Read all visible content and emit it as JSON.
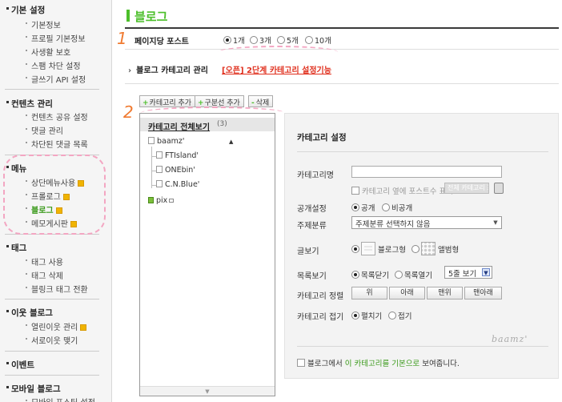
{
  "sidebar": {
    "sections": [
      {
        "title": "기본 설정",
        "items": [
          {
            "label": "기본정보",
            "badge": false
          },
          {
            "label": "프로필 기본정보",
            "badge": false
          },
          {
            "label": "사생활 보호",
            "badge": false
          },
          {
            "label": "스팸 차단 설정",
            "badge": false
          },
          {
            "label": "글쓰기 API 설정",
            "badge": false
          }
        ]
      },
      {
        "title": "컨텐츠 관리",
        "items": [
          {
            "label": "컨텐츠 공유 설정",
            "badge": false
          },
          {
            "label": "댓글 관리",
            "badge": false
          },
          {
            "label": "차단된 댓글 목록",
            "badge": false
          }
        ]
      },
      {
        "title": "메뉴",
        "items": [
          {
            "label": "상단메뉴사용",
            "badge": true
          },
          {
            "label": "프롤로그",
            "badge": true
          },
          {
            "label": "블로그",
            "badge": true,
            "active": true
          },
          {
            "label": "메모게시판",
            "badge": true
          }
        ]
      },
      {
        "title": "태그",
        "items": [
          {
            "label": "태그 사용",
            "badge": false
          },
          {
            "label": "태그 삭제",
            "badge": false
          },
          {
            "label": "블링크 태그 전환",
            "badge": false
          }
        ]
      },
      {
        "title": "이웃 블로그",
        "items": [
          {
            "label": "열린이웃 관리",
            "badge": true
          },
          {
            "label": "서로이웃 맺기",
            "badge": false
          }
        ]
      },
      {
        "title": "이벤트",
        "items": []
      },
      {
        "title": "모바일 블로그",
        "items": [
          {
            "label": "모바일 포스팅 설정",
            "badge": false
          }
        ]
      }
    ]
  },
  "header": {
    "title": "블로그"
  },
  "posts_per_page": {
    "label": "페이지당 포스트",
    "options": [
      "1개",
      "3개",
      "5개",
      "10개"
    ],
    "selected": "1개"
  },
  "category_management": {
    "label": "블로그 카테고리 관리",
    "link": "[오픈] 2단계 카테고리 설정기능"
  },
  "toolbar": {
    "add_category": "카테고리 추가",
    "add_divider": "구분선 추가",
    "delete": "삭제"
  },
  "tree": {
    "header_label": "카테고리 전체보기",
    "header_count": "(3)",
    "parent": "baamz'",
    "children": [
      "FTIsland'",
      "ONEbin'",
      "C.N.Blue'"
    ],
    "other": "pix"
  },
  "settings": {
    "title": "카테고리 설정",
    "name_label": "카테고리명",
    "name_value": "",
    "show_count_label": "카테고리 옆에 포스트수 표시",
    "show_count_badge": "전체 카테고리 표시",
    "visibility_label": "공개설정",
    "visibility_options": [
      "공개",
      "비공개"
    ],
    "visibility_selected": "공개",
    "topic_label": "주제분류",
    "topic_value": "주제분류 선택하지 않음",
    "view_label": "글보기",
    "view_options": [
      "블로그형",
      "앨범형"
    ],
    "view_selected": "블로그형",
    "list_label": "목록보기",
    "list_options": [
      "목록닫기",
      "목록열기"
    ],
    "list_selected": "목록닫기",
    "list_count_value": "5줄 보기",
    "sort_label": "카테고리 정렬",
    "sort_buttons": [
      "위",
      "아래",
      "맨위",
      "맨아래"
    ],
    "fold_label": "카테고리 접기",
    "fold_options": [
      "펼치기",
      "접기"
    ],
    "fold_selected": "펼치기",
    "default_prefix": "블로그에서 ",
    "default_highlight": "이 카테고리를 기본으로",
    "default_suffix": " 보여줍니다.",
    "watermark": "baamz'"
  },
  "annotations": {
    "label_1": "1",
    "label_2": "2",
    "color": "#f3a6c2",
    "number_color": "#f07a30"
  },
  "colors": {
    "accent": "#4cbf2a",
    "link_red": "#e0301e"
  }
}
